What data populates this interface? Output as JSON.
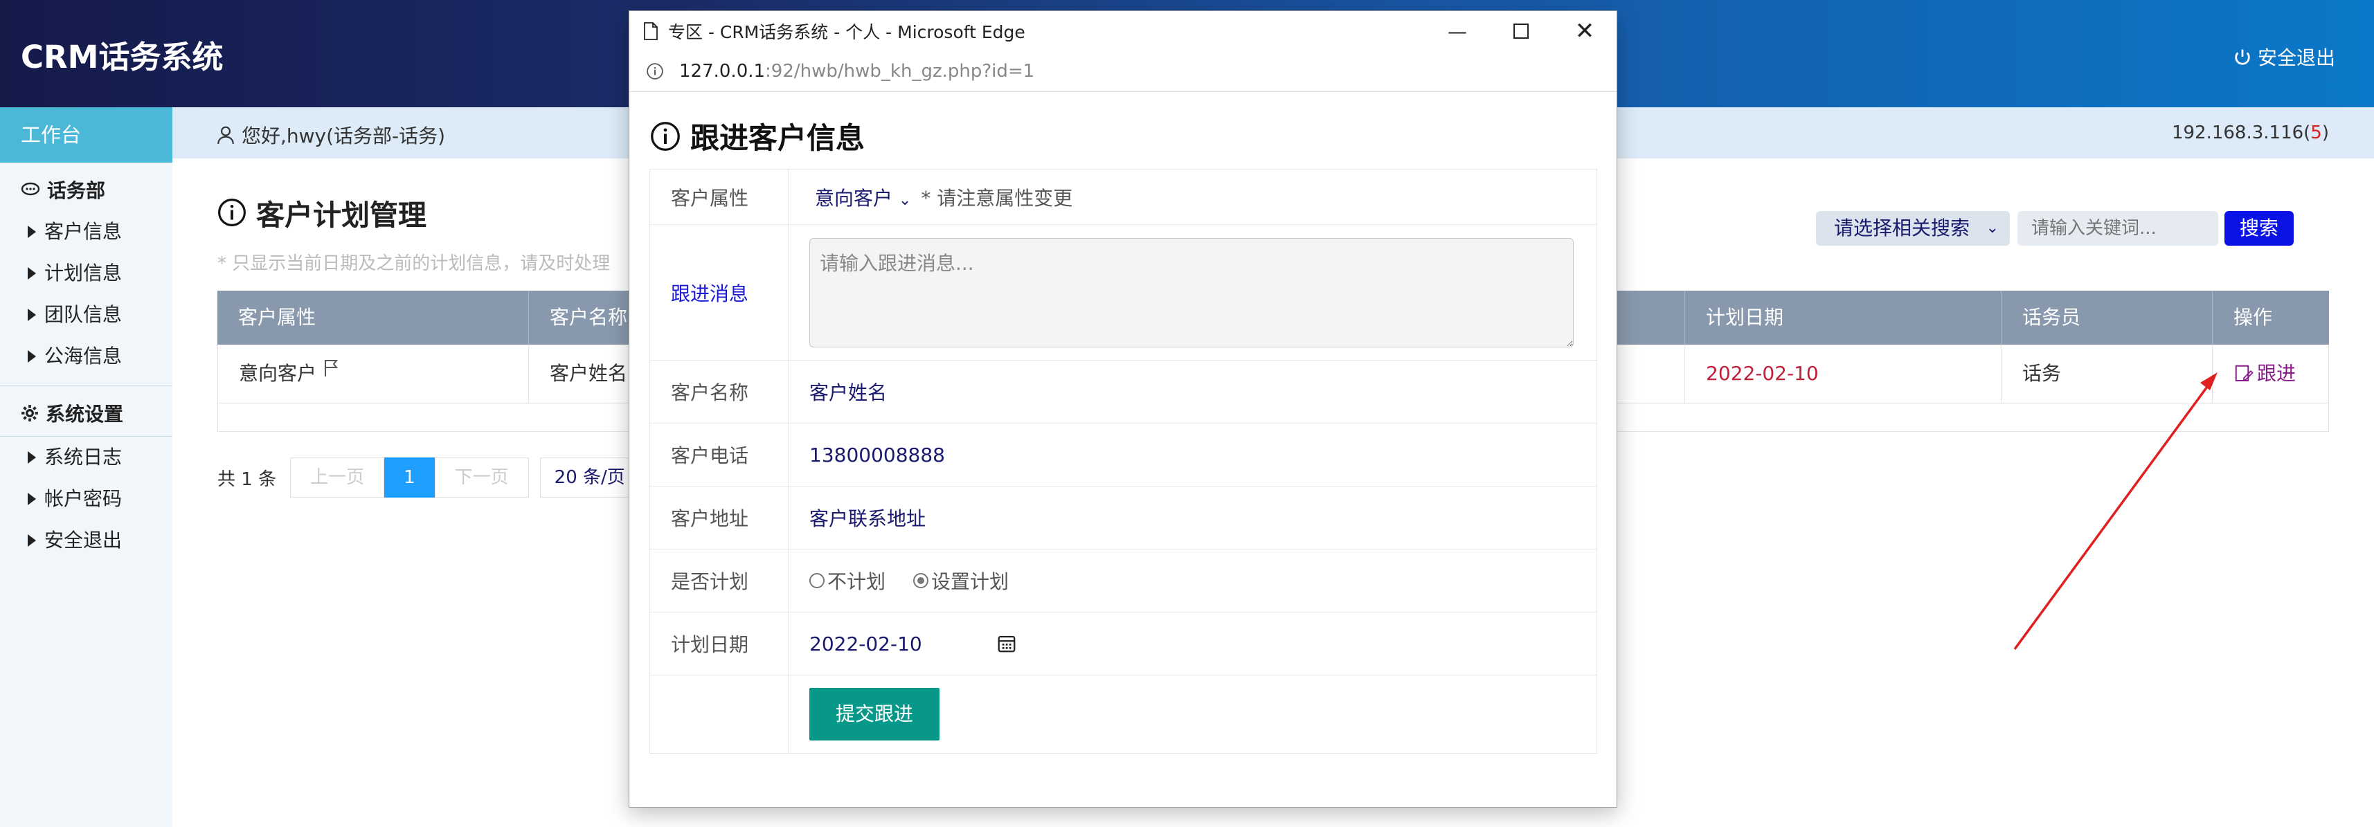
{
  "app": {
    "brand": "CRM话务系统",
    "logout_top": "安全退出"
  },
  "sidebar": {
    "workbench": "工作台",
    "section1": "话务部",
    "items1": [
      "客户信息",
      "计划信息",
      "团队信息",
      "公海信息"
    ],
    "section2": "系统设置",
    "items2": [
      "系统日志",
      "帐户密码",
      "安全退出"
    ]
  },
  "topbar": {
    "greeting": "您好,hwy(话务部-话务)",
    "ip": "192.168.3.116(",
    "ip_count": "5",
    "ip_close": ")"
  },
  "page": {
    "title": "客户计划管理",
    "hint": "* 只显示当前日期及之前的计划信息，请及时处理"
  },
  "search": {
    "select_label": "请选择相关搜索",
    "input_placeholder": "请输入关键词...",
    "button": "搜索"
  },
  "table": {
    "headers": [
      "客户属性",
      "客户名称",
      "计划日期",
      "话务员",
      "操作"
    ],
    "row": {
      "attr": "意向客户",
      "name": "客户姓名",
      "date": "2022-02-10",
      "agent": "话务",
      "action": "跟进"
    }
  },
  "pager": {
    "total": "共 1 条",
    "prev": "上一页",
    "current": "1",
    "next": "下一页",
    "size": "20 条/页"
  },
  "popup": {
    "window_title": "专区 - CRM话务系统 - 个人 - Microsoft Edge",
    "url_host": "127.0.0.1",
    "url_rest": ":92/hwb/hwb_kh_gz.php?id=1",
    "title": "跟进客户信息",
    "fields": {
      "attr_label": "客户属性",
      "attr_value": "意向客户",
      "attr_note": "* 请注意属性变更",
      "msg_label": "跟进消息",
      "msg_placeholder": "请输入跟进消息...",
      "name_label": "客户名称",
      "name_value": "客户姓名",
      "phone_label": "客户电话",
      "phone_value": "13800008888",
      "addr_label": "客户地址",
      "addr_value": "客户联系地址",
      "plan_label": "是否计划",
      "plan_no": "不计划",
      "plan_yes": "设置计划",
      "date_label": "计划日期",
      "date_value": "2022-02-10",
      "submit": "提交跟进"
    }
  },
  "colors": {
    "header_start": "#151a49",
    "header_end": "#0a78c8",
    "accent_cyan": "#4ab8d6",
    "submit_green": "#089889",
    "search_blue": "#0a12e6",
    "arrow_red": "#e02020"
  }
}
